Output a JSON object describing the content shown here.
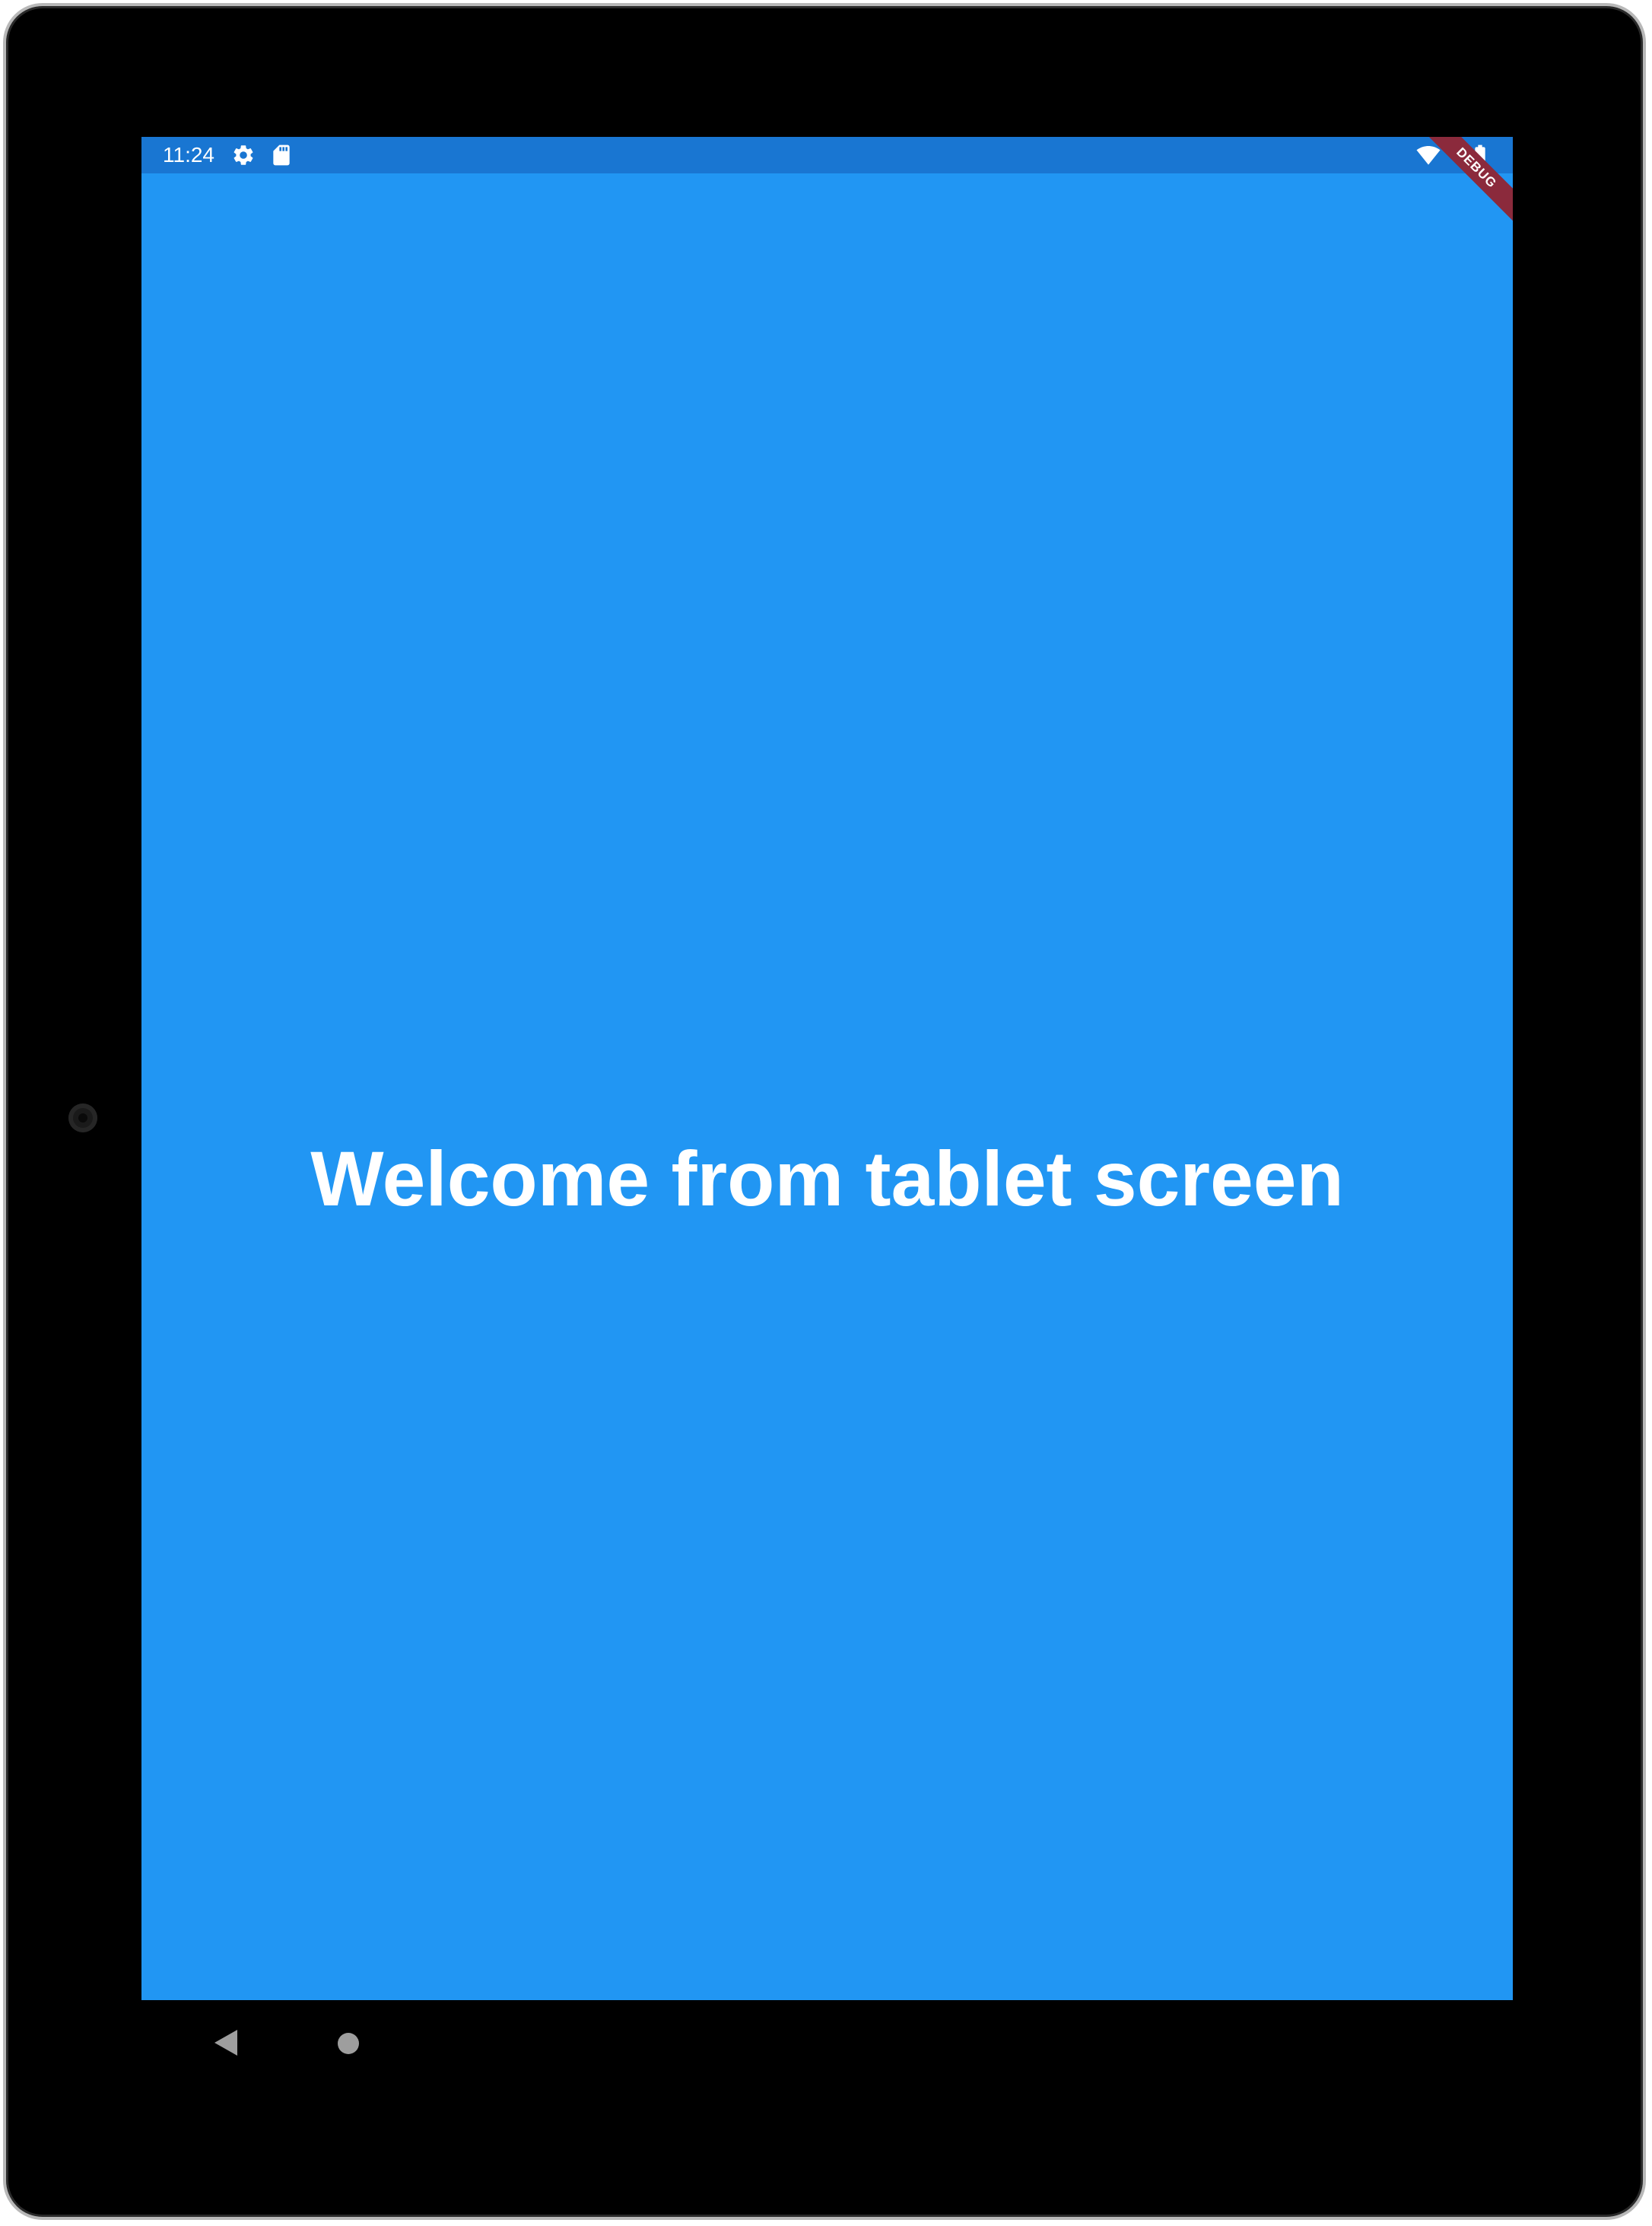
{
  "status_bar": {
    "time": "11:24",
    "icons": [
      "settings-gear-icon",
      "sd-card-icon",
      "wifi-icon",
      "battery-icon"
    ]
  },
  "debug_banner": "DEBUG",
  "main": {
    "welcome_text": "Welcome from tablet screen"
  },
  "navigation": {
    "icons": [
      "back-icon",
      "home-icon"
    ]
  },
  "colors": {
    "screen_background": "#2196f3",
    "status_bar": "#1976d2",
    "debug_banner": "#8b2a3c",
    "text": "#ffffff"
  }
}
